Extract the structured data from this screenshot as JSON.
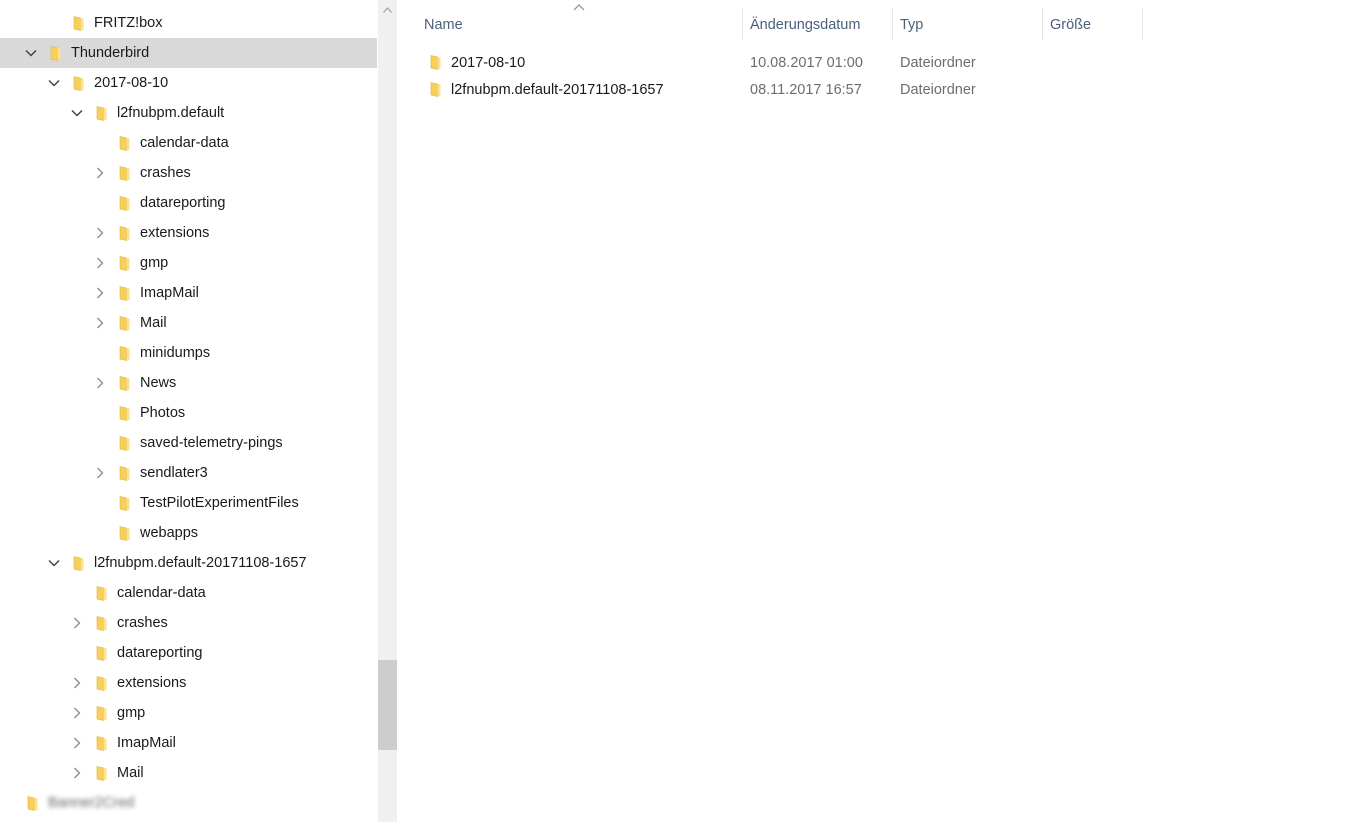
{
  "colors": {
    "folder": "#f7cf5a",
    "selected_bg": "#d9d9d9",
    "header_text": "#4c607a"
  },
  "nav": {
    "items": [
      {
        "label": "FRITZ!box",
        "level": 2,
        "expander": "none"
      },
      {
        "label": "Thunderbird",
        "level": 1,
        "expander": "expanded",
        "selected": true
      },
      {
        "label": "2017-08-10",
        "level": 2,
        "expander": "expanded"
      },
      {
        "label": "l2fnubpm.default",
        "level": 3,
        "expander": "expanded"
      },
      {
        "label": "calendar-data",
        "level": 4,
        "expander": "none"
      },
      {
        "label": "crashes",
        "level": 4,
        "expander": "collapsed"
      },
      {
        "label": "datareporting",
        "level": 4,
        "expander": "none"
      },
      {
        "label": "extensions",
        "level": 4,
        "expander": "collapsed"
      },
      {
        "label": "gmp",
        "level": 4,
        "expander": "collapsed"
      },
      {
        "label": "ImapMail",
        "level": 4,
        "expander": "collapsed"
      },
      {
        "label": "Mail",
        "level": 4,
        "expander": "collapsed"
      },
      {
        "label": "minidumps",
        "level": 4,
        "expander": "none"
      },
      {
        "label": "News",
        "level": 4,
        "expander": "collapsed"
      },
      {
        "label": "Photos",
        "level": 4,
        "expander": "none"
      },
      {
        "label": "saved-telemetry-pings",
        "level": 4,
        "expander": "none"
      },
      {
        "label": "sendlater3",
        "level": 4,
        "expander": "collapsed"
      },
      {
        "label": "TestPilotExperimentFiles",
        "level": 4,
        "expander": "none"
      },
      {
        "label": "webapps",
        "level": 4,
        "expander": "none"
      },
      {
        "label": "l2fnubpm.default-20171108-1657",
        "level": 2,
        "expander": "expanded"
      },
      {
        "label": "calendar-data",
        "level": 3,
        "expander": "none"
      },
      {
        "label": "crashes",
        "level": 3,
        "expander": "collapsed"
      },
      {
        "label": "datareporting",
        "level": 3,
        "expander": "none"
      },
      {
        "label": "extensions",
        "level": 3,
        "expander": "collapsed"
      },
      {
        "label": "gmp",
        "level": 3,
        "expander": "collapsed"
      },
      {
        "label": "ImapMail",
        "level": 3,
        "expander": "collapsed"
      },
      {
        "label": "Mail",
        "level": 3,
        "expander": "collapsed"
      },
      {
        "label": "Banner2Cred",
        "level": 0,
        "expander": "none",
        "blurred": true
      }
    ]
  },
  "columns": {
    "name": "Name",
    "date": "Änderungsdatum",
    "type": "Typ",
    "size": "Größe"
  },
  "files": [
    {
      "name": "2017-08-10",
      "date": "10.08.2017 01:00",
      "type": "Dateiordner"
    },
    {
      "name": "l2fnubpm.default-20171108-1657",
      "date": "08.11.2017 16:57",
      "type": "Dateiordner"
    }
  ]
}
